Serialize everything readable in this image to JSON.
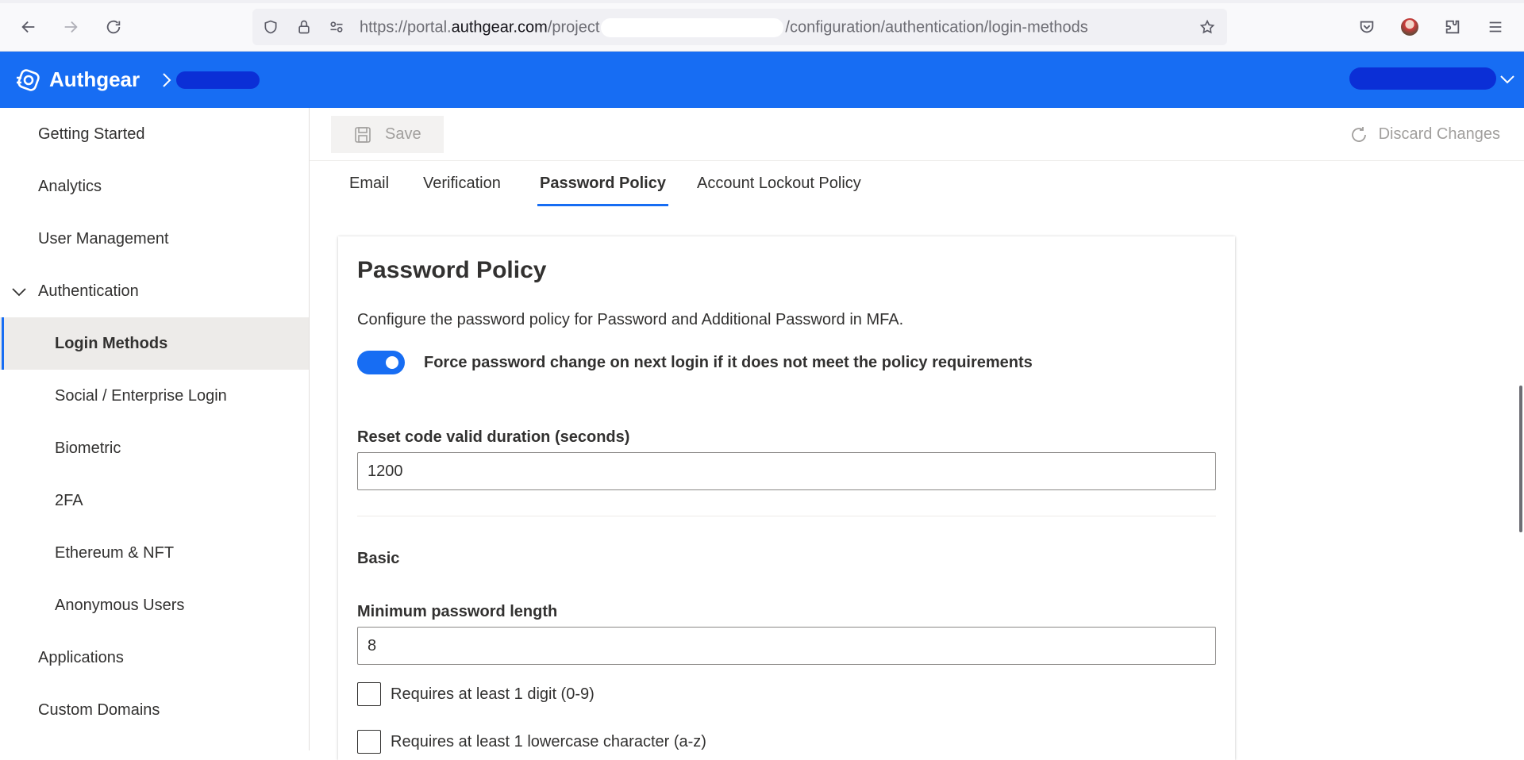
{
  "browser": {
    "url_prefix": "https://portal.",
    "url_host": "authgear.com",
    "url_mid": "/project",
    "url_suffix": "/configuration/authentication/login-methods",
    "icons": [
      "back-icon",
      "forward-icon",
      "reload-icon",
      "shield-icon",
      "lock-icon",
      "permissions-icon",
      "star-icon",
      "pocket-icon",
      "profile-avatar-icon",
      "extensions-icon",
      "menu-icon"
    ]
  },
  "header": {
    "brand": "Authgear",
    "colors": {
      "header_bg": "#176df3",
      "accent": "#176df3"
    }
  },
  "sidebar": {
    "items": [
      {
        "label": "Getting Started"
      },
      {
        "label": "Analytics"
      },
      {
        "label": "User Management"
      },
      {
        "label": "Authentication"
      },
      {
        "label": "Login Methods"
      },
      {
        "label": "Social / Enterprise Login"
      },
      {
        "label": "Biometric"
      },
      {
        "label": "2FA"
      },
      {
        "label": "Ethereum & NFT"
      },
      {
        "label": "Anonymous Users"
      },
      {
        "label": "Applications"
      },
      {
        "label": "Custom Domains"
      }
    ],
    "selected": "Login Methods"
  },
  "toolbar": {
    "save_label": "Save",
    "discard_label": "Discard Changes"
  },
  "tabs": [
    {
      "label": "Email"
    },
    {
      "label": "Verification"
    },
    {
      "label": "Password Policy"
    },
    {
      "label": "Account Lockout Policy"
    }
  ],
  "active_tab": "Password Policy",
  "policy": {
    "title": "Password Policy",
    "description": "Configure the password policy for Password and Additional Password in MFA.",
    "force_change_label": "Force password change on next login if it does not meet the policy requirements",
    "force_change_enabled": true,
    "reset_label": "Reset code valid duration (seconds)",
    "reset_value": "1200",
    "basic_title": "Basic",
    "min_length_label": "Minimum password length",
    "min_length_value": "8",
    "checks": [
      {
        "label": "Requires at least 1 digit (0-9)",
        "checked": false
      },
      {
        "label": "Requires at least 1 lowercase character (a-z)",
        "checked": false
      }
    ]
  }
}
